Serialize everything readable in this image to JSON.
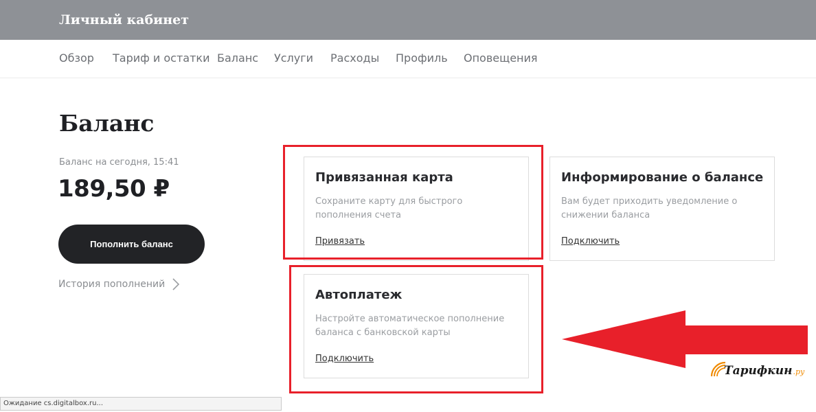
{
  "header": {
    "title": "Личный кабинет"
  },
  "nav": {
    "items": [
      {
        "label": "Обзор"
      },
      {
        "label": "Тариф и остатки"
      },
      {
        "label": "Баланс"
      },
      {
        "label": "Услуги"
      },
      {
        "label": "Расходы"
      },
      {
        "label": "Профиль"
      },
      {
        "label": "Оповещения"
      }
    ]
  },
  "page": {
    "title": "Баланс",
    "balance_date": "Баланс на сегодня, 15:41",
    "balance_amount": "189,50 ₽",
    "topup_label": "Пополнить баланс",
    "history_label": "История пополнений"
  },
  "cards": [
    {
      "title": "Привязанная карта",
      "desc": "Сохраните карту для быстрого пополнения счета",
      "link": "Привязать"
    },
    {
      "title": "Информирование о балансе",
      "desc": "Вам будет приходить уведомление о снижении баланса",
      "link": "Подключить"
    },
    {
      "title": "Автоплатеж",
      "desc": "Настройте автоматическое пополнение баланса с банковской карты",
      "link": "Подключить"
    }
  ],
  "annotation": {
    "color": "#e8202a"
  },
  "watermark": {
    "text": "Тарифкин",
    "suffix": ".ру"
  },
  "statusbar": {
    "text": "Ожидание cs.digitalbox.ru..."
  },
  "colors": {
    "topbar": "#8e9196",
    "button": "#222326",
    "accent": "#f08a00"
  }
}
